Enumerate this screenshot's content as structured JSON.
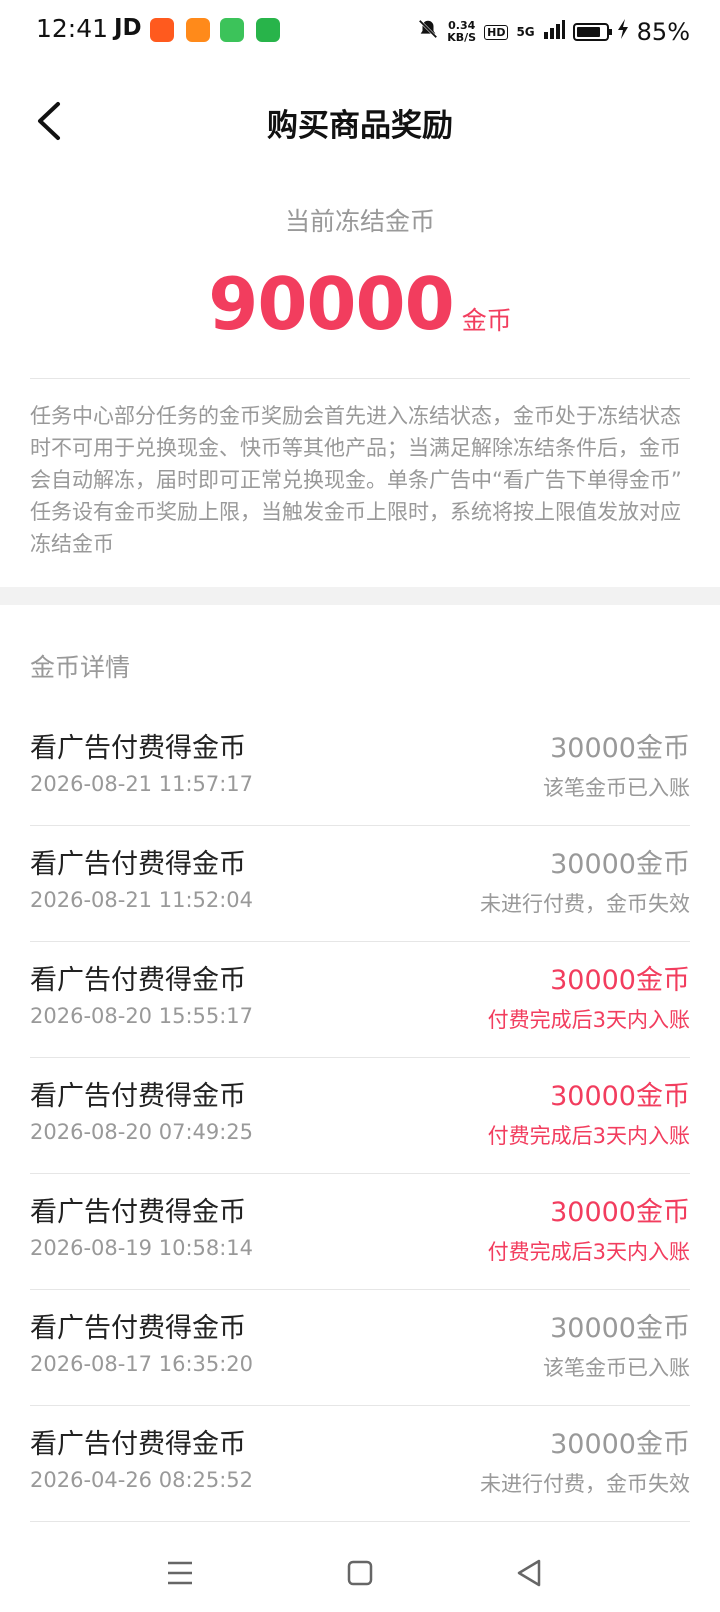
{
  "status_bar": {
    "time": "12:41",
    "carrier": "JD",
    "net_speed_value": "0.34",
    "net_speed_unit": "KB/S",
    "hd": "HD",
    "signal": "5G",
    "battery_percent_text": "85%",
    "battery_level": 0.85,
    "icons": [
      "taobao-icon",
      "app-icon",
      "messages-icon",
      "phone-icon",
      "mute-bell-icon",
      "charging-icon"
    ]
  },
  "header": {
    "title": "购买商品奖励"
  },
  "frozen": {
    "label": "当前冻结金币",
    "amount": "90000",
    "unit": "金币"
  },
  "description": "任务中心部分任务的金币奖励会首先进入冻结状态，金币处于冻结状态时不可用于兑换现金、快币等其他产品；当满足解除冻结条件后，金币会自动解冻，届时即可正常兑换现金。单条广告中“看广告下单得金币” 任务设有金币奖励上限，当触发金币上限时，系统将按上限值发放对应冻结金币",
  "details": {
    "title": "金币详情",
    "items": [
      {
        "name": "看广告付费得金币",
        "time": "2026-08-21 11:57:17",
        "amount": "30000金币",
        "status": "该笔金币已入账",
        "pending": false
      },
      {
        "name": "看广告付费得金币",
        "time": "2026-08-21 11:52:04",
        "amount": "30000金币",
        "status": "未进行付费，金币失效",
        "pending": false
      },
      {
        "name": "看广告付费得金币",
        "time": "2026-08-20 15:55:17",
        "amount": "30000金币",
        "status": "付费完成后3天内入账",
        "pending": true
      },
      {
        "name": "看广告付费得金币",
        "time": "2026-08-20 07:49:25",
        "amount": "30000金币",
        "status": "付费完成后3天内入账",
        "pending": true
      },
      {
        "name": "看广告付费得金币",
        "time": "2026-08-19 10:58:14",
        "amount": "30000金币",
        "status": "付费完成后3天内入账",
        "pending": true
      },
      {
        "name": "看广告付费得金币",
        "time": "2026-08-17 16:35:20",
        "amount": "30000金币",
        "status": "该笔金币已入账",
        "pending": false
      },
      {
        "name": "看广告付费得金币",
        "time": "2026-04-26 08:25:52",
        "amount": "30000金币",
        "status": "未进行付费，金币失效",
        "pending": false
      }
    ]
  },
  "colors": {
    "accent": "#f23d5e",
    "muted": "#999999",
    "divider": "#e6e6e6"
  },
  "nav_icons": [
    "menu-icon",
    "home-square-icon",
    "back-triangle-icon"
  ]
}
